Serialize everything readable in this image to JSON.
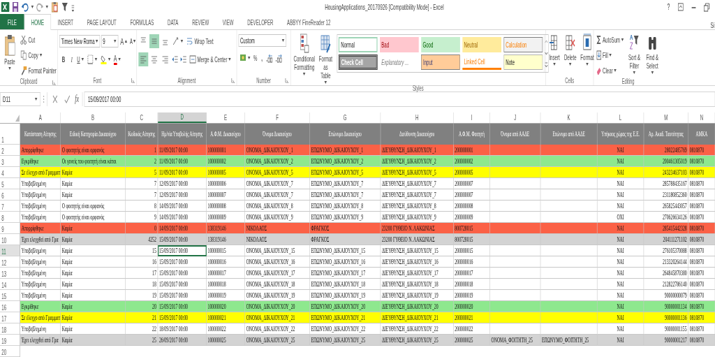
{
  "title_bar": {
    "title": "HousingApplications_20170926  [Compatibility Mode] - Excel",
    "help": "?"
  },
  "tabs": [
    {
      "label": "FILE",
      "kind": "file",
      "selected": false
    },
    {
      "label": "HOME",
      "kind": "tab",
      "selected": true
    },
    {
      "label": "INSERT",
      "kind": "tab",
      "selected": false
    },
    {
      "label": "PAGE LAYOUT",
      "kind": "tab",
      "selected": false
    },
    {
      "label": "FORMULAS",
      "kind": "tab",
      "selected": false
    },
    {
      "label": "DATA",
      "kind": "tab",
      "selected": false
    },
    {
      "label": "REVIEW",
      "kind": "tab",
      "selected": false
    },
    {
      "label": "VIEW",
      "kind": "tab",
      "selected": false
    },
    {
      "label": "DEVELOPER",
      "kind": "tab",
      "selected": false
    },
    {
      "label": "ABBYY FineReader 12",
      "kind": "tab",
      "selected": false
    }
  ],
  "account_label": "Si",
  "ribbon": {
    "clipboard": {
      "label": "Clipboard",
      "paste": "Paste",
      "cut": "Cut",
      "copy": "Copy",
      "format_painter": "Format Painter"
    },
    "font": {
      "label": "Font",
      "font_name": "Times New Roma",
      "font_size": "9",
      "grow": "A",
      "shrink": "A",
      "bold": "B",
      "italic": "I",
      "underline": "U",
      "font_color": "A"
    },
    "alignment": {
      "label": "Alignment",
      "top_row": [
        {
          "kind": "top",
          "selected": false
        },
        {
          "kind": "middle",
          "selected": true
        },
        {
          "kind": "bottom",
          "selected": false
        }
      ],
      "bottom_row": [
        {
          "kind": "left",
          "selected": true
        },
        {
          "kind": "center",
          "selected": false
        },
        {
          "kind": "right",
          "selected": false
        }
      ],
      "wrap_text": "Wrap Text",
      "merge_center": "Merge & Center"
    },
    "number": {
      "label": "Number",
      "format": "Custom",
      "percent": "%",
      "comma": ","
    },
    "styles": {
      "label": "Styles",
      "conditional_formatting": "Conditional Formatting",
      "format_as_table": "Format as Table",
      "gallery": [
        {
          "name": "Normal",
          "kind": "normal"
        },
        {
          "name": "Bad",
          "kind": "bad"
        },
        {
          "name": "Good",
          "kind": "good"
        },
        {
          "name": "Neutral",
          "kind": "neutral"
        },
        {
          "name": "Calculation",
          "kind": "calculation"
        },
        {
          "name": "Check Cell",
          "kind": "check"
        },
        {
          "name": "Explanatory ...",
          "kind": "explanatory"
        },
        {
          "name": "Input",
          "kind": "input"
        },
        {
          "name": "Linked Cell",
          "kind": "linked"
        },
        {
          "name": "Note",
          "kind": "note"
        }
      ]
    },
    "cells": {
      "label": "Cells",
      "insert": "Insert",
      "delete": "Delete",
      "format": "Format"
    },
    "editing": {
      "label": "Editing",
      "autosum": "AutoSum",
      "fill": "Fill",
      "clear": "Clear",
      "sort_filter": "Sort & Filter",
      "find_select": "Find & Select"
    }
  },
  "formula_bar": {
    "name_box": "D11",
    "fx": "fx",
    "value": "15/09/2017 00:00"
  },
  "sheet": {
    "columns": [
      {
        "letter": "A",
        "header": "Κατάσταση Αίτησης",
        "kind": "text",
        "selected": false
      },
      {
        "letter": "B",
        "header": "Ειδική Κατηγορία Δικαιούχου",
        "kind": "text",
        "selected": false
      },
      {
        "letter": "C",
        "header": "Κωδικός Αίτησης",
        "kind": "number",
        "selected": false
      },
      {
        "letter": "D",
        "header": "Ημ/νία Υποβολής Αίτησης",
        "kind": "text",
        "selected": true
      },
      {
        "letter": "E",
        "header": "Α.Φ.Μ. Δικαιούχου",
        "kind": "text",
        "selected": false
      },
      {
        "letter": "F",
        "header": "Όνομα Δικαιούχου",
        "kind": "text",
        "selected": false
      },
      {
        "letter": "G",
        "header": "Επώνυμο Δικαιούχου",
        "kind": "text",
        "selected": false
      },
      {
        "letter": "H",
        "header": "Διεύθυνση Δικαιούχου",
        "kind": "text",
        "selected": false
      },
      {
        "letter": "I",
        "header": "Α.Φ.Μ. Φοιτητή",
        "kind": "text",
        "selected": false
      },
      {
        "letter": "J",
        "header": "Όνομα από ΑΑΔΕ",
        "kind": "text",
        "selected": false
      },
      {
        "letter": "K",
        "header": "Επώνυμο από ΑΑΔΕ",
        "kind": "text",
        "selected": false
      },
      {
        "letter": "L",
        "header": "Υπήκοος χώρας της Ε.Ε.",
        "kind": "flag",
        "selected": false
      },
      {
        "letter": "M",
        "header": "Αρ. Ακαδ. Ταυτότητας",
        "kind": "number",
        "selected": false
      },
      {
        "letter": "N",
        "header": "ΑΜΚΑ",
        "kind": "text",
        "selected": false
      }
    ],
    "header_row_number": "1",
    "rows": [
      {
        "number": "2",
        "color": "#fb6146",
        "selected": false,
        "cells": {
          "A": "Απορρίφθηκε",
          "B": "Ο φοιτητής είναι ορφανός",
          "C": "1",
          "D": "11/09/2017 00:00",
          "E": "100000001",
          "F": "ΟΝΟΜΑ_ΔΙΚΑΙΟΥΧΟΥ_1",
          "G": "ΕΠΩΝΥΜΟ_ΔΙΚΑΙΟΥΧΟΥ_1",
          "H": "ΔΙΕΥΘΥΝΣΗ_ΔΙΚΑΙΟΥΧΟΥ_1",
          "I": "200000001",
          "L": "ΝΑΙ",
          "M": "28022485769",
          "N": "0810870"
        }
      },
      {
        "number": "3",
        "color": "#8ee88e",
        "selected": false,
        "cells": {
          "A": "Εγκρίθηκε",
          "B": "Οι γονείς του φοιτητή είναι κάτοι",
          "C": "2",
          "D": "11/09/2017 00:00",
          "E": "100000002",
          "F": "ΟΝΟΜΑ_ΔΙΚΑΙΟΥΧΟΥ_2",
          "G": "ΕΠΩΝΥΜΟ_ΔΙΚΑΙΟΥΧΟΥ_2",
          "H": "ΔΙΕΥΘΥΝΣΗ_ΔΙΚΑΙΟΥΧΟΥ_2",
          "I": "200000002",
          "L": "ΝΑΙ",
          "M": "200461305019",
          "N": "0810870"
        }
      },
      {
        "number": "4",
        "color": "#ffff00",
        "selected": false,
        "cells": {
          "A": "Σε έλεγχο από Γραμματ",
          "B": "Καμία",
          "C": "5",
          "D": "11/09/2017 00:00",
          "E": "100000005",
          "F": "ΟΝΟΜΑ_ΔΙΚΑΙΟΥΧΟΥ_5",
          "G": "ΕΠΩΝΥΜΟ_ΔΙΚΑΙΟΥΧΟΥ_5",
          "H": "ΔΙΕΥΘΥΝΣΗ_ΔΙΚΑΙΟΥΧΟΥ_5",
          "I": "200000005",
          "L": "ΝΑΙ",
          "M": "243234637103",
          "N": "0810870"
        }
      },
      {
        "number": "5",
        "color": "#ffffff",
        "selected": false,
        "cells": {
          "A": "Υποβεβλημένη",
          "B": "Καμία",
          "C": "7",
          "D": "12/09/2017 00:00",
          "E": "100000006",
          "F": "ΟΝΟΜΑ_ΔΙΚΑΙΟΥΧΟΥ_7",
          "G": "ΕΠΩΝΥΜΟ_ΔΙΚΑΙΟΥΧΟΥ_7",
          "H": "ΔΙΕΥΘΥΝΣΗ_ΔΙΚΑΙΟΥΧΟΥ_7",
          "I": "200000007",
          "L": "ΝΑΙ",
          "M": "285788435167",
          "N": "0810870"
        }
      },
      {
        "number": "6",
        "color": "#ffffff",
        "selected": false,
        "cells": {
          "A": "Υποβεβλημένη",
          "B": "Καμία",
          "C": "7",
          "D": "12/09/2017 00:00",
          "E": "100000007",
          "F": "ΟΝΟΜΑ_ΔΙΚΑΙΟΥΧΟΥ_7",
          "G": "ΕΠΩΝΥΜΟ_ΔΙΚΑΙΟΥΧΟΥ_7",
          "H": "ΔΙΕΥΘΥΝΣΗ_ΔΙΚΑΙΟΥΧΟΥ_7",
          "I": "200000007",
          "L": "ΝΑΙ",
          "M": "231180852360",
          "N": "0810870"
        }
      },
      {
        "number": "7",
        "color": "#ffffff",
        "selected": false,
        "cells": {
          "A": "Υποβεβλημένη",
          "B": "Ο φοιτητής είναι ορφανός",
          "C": "8",
          "D": "14/09/2017 00:00",
          "E": "100000008",
          "F": "ΟΝΟΜΑ_ΔΙΚΑΙΟΥΧΟΥ_8",
          "G": "ΕΠΩΝΥΜΟ_ΔΙΚΑΙΟΥΧΟΥ_8",
          "H": "ΔΙΕΥΘΥΝΣΗ_ΔΙΚΑΙΟΥΧΟΥ_8",
          "I": "200000008",
          "L": "ΝΑΙ",
          "M": "265825443057",
          "N": "0810870"
        }
      },
      {
        "number": "8",
        "color": "#ffffff",
        "selected": false,
        "cells": {
          "A": "Υποβεβλημένη",
          "B": "Ο φοιτητής είναι ορφανός",
          "C": "9",
          "D": "14/09/2017 00:00",
          "E": "100000009",
          "F": "ΟΝΟΜΑ_ΔΙΚΑΙΟΥΧΟΥ_9",
          "G": "ΕΠΩΝΥΜΟ_ΔΙΚΑΙΟΥΧΟΥ_9",
          "H": "ΔΙΕΥΘΥΝΣΗ_ΔΙΚΑΙΟΥΧΟΥ_9",
          "I": "200000009",
          "L": "ΟΧΙ",
          "M": "270626634126",
          "N": "0810870"
        }
      },
      {
        "number": "9",
        "color": "#fb6146",
        "selected": false,
        "cells": {
          "A": "Απορρίφθηκε",
          "B": "Καμία",
          "C": "0",
          "D": "14/09/2017 00:00",
          "E": "138319146",
          "F": "ΝΙΚΟΛΑΟΣ",
          "G": "ΦΡΑΓΚΟΣ",
          "H": "23200  ΓΥΘΕΙΟ  Ν. ΛΑΚΩΝΙΑΣ",
          "I": "800728015",
          "L": "ΝΑΙ",
          "M": "285415442328",
          "N": "0810870"
        }
      },
      {
        "number": "10",
        "color": "#d3d3d3",
        "selected": false,
        "cells": {
          "A": "Έχει ελεγχθεί από Γρα",
          "B": "Καμία",
          "C": "4252",
          "D": "15/09/2017 00:00",
          "E": "138319146",
          "F": "ΝΙΚΟΛΑΟΣ",
          "G": "ΦΡΑΓΚΟΣ",
          "H": "23200  ΓΥΘΕΙΟ  Ν. ΛΑΚΩΝΙΑΣ",
          "I": "800728015",
          "L": "ΝΑΙ",
          "M": "204111271102",
          "N": "0810870"
        }
      },
      {
        "number": "11",
        "color": "#ffffff",
        "selected": true,
        "cells": {
          "A": "Υποβεβλημένη",
          "B": "Καμία",
          "C": "15",
          "D": "15/09/2017 00:00",
          "E": "100000015",
          "F": "ΟΝΟΜΑ_ΔΙΚΑΙΟΥΧΟΥ_15",
          "G": "ΕΠΩΝΥΜΟ_ΔΙΚΑΙΟΥΧΟΥ_15",
          "H": "ΔΙΕΥΘΥΝΣΗ_ΔΙΚΑΙΟΥΧΟΥ_15",
          "I": "200000015",
          "L": "ΝΑΙ",
          "M": "276105370088",
          "N": "0810870"
        }
      },
      {
        "number": "12",
        "color": "#ffffff",
        "selected": false,
        "cells": {
          "A": "Υποβεβλημένη",
          "B": "Καμία",
          "C": "16",
          "D": "15/09/2017 00:00",
          "E": "100000016",
          "F": "ΟΝΟΜΑ_ΔΙΚΑΙΟΥΧΟΥ_16",
          "G": "ΕΠΩΝΥΜΟ_ΔΙΚΑΙΟΥΧΟΥ_16",
          "H": "ΔΙΕΥΘΥΝΣΗ_ΔΙΚΑΙΟΥΧΟΥ_16",
          "I": "200000016",
          "L": "ΝΑΙ",
          "M": "213320264144",
          "N": "0810870"
        }
      },
      {
        "number": "13",
        "color": "#ffffff",
        "selected": false,
        "cells": {
          "A": "Υποβεβλημένη",
          "B": "Καμία",
          "C": "17",
          "D": "15/09/2017 00:00",
          "E": "100000017",
          "F": "ΟΝΟΜΑ_ΔΙΚΑΙΟΥΧΟΥ_17",
          "G": "ΕΠΩΝΥΜΟ_ΔΙΚΑΙΟΥΧΟΥ_17",
          "H": "ΔΙΕΥΘΥΝΣΗ_ΔΙΚΑΙΟΥΧΟΥ_17",
          "I": "200000017",
          "L": "ΝΑΙ",
          "M": "264845870380",
          "N": "0810870"
        }
      },
      {
        "number": "14",
        "color": "#ffffff",
        "selected": false,
        "cells": {
          "A": "Υποβεβλημένη",
          "B": "Καμία",
          "C": "18",
          "D": "15/09/2017 00:00",
          "E": "100000018",
          "F": "ΟΝΟΜΑ_ΔΙΚΑΙΟΥΧΟΥ_18",
          "G": "ΕΠΩΝΥΜΟ_ΔΙΚΑΙΟΥΧΟΥ_18",
          "H": "ΔΙΕΥΘΥΝΣΗ_ΔΙΚΑΙΟΥΧΟΥ_18",
          "I": "200000018",
          "L": "ΝΑΙ",
          "M": "212822786140",
          "N": "0810870"
        }
      },
      {
        "number": "15",
        "color": "#ffffff",
        "selected": false,
        "cells": {
          "A": "Υποβεβλημένη",
          "B": "Καμία",
          "C": "19",
          "D": "15/09/2017 00:00",
          "E": "100000019",
          "F": "ΟΝΟΜΑ_ΔΙΚΑΙΟΥΧΟΥ_19",
          "G": "ΕΠΩΝΥΜΟ_ΔΙΚΑΙΟΥΧΟΥ_19",
          "H": "ΔΙΕΥΘΥΝΣΗ_ΔΙΚΑΙΟΥΧΟΥ_19",
          "I": "200000019",
          "L": "ΝΑΙ",
          "M": "90000000079",
          "N": "0810870"
        }
      },
      {
        "number": "16",
        "color": "#8ee88e",
        "selected": false,
        "cells": {
          "A": "Εγκρίθηκε",
          "B": "Καμία",
          "C": "20",
          "D": "15/09/2017 00:00",
          "E": "100000020",
          "F": "ΟΝΟΜΑ_ΔΙΚΑΙΟΥΧΟΥ_20",
          "G": "ΕΠΩΝΥΜΟ_ΔΙΚΑΙΟΥΧΟΥ_20",
          "H": "ΔΙΕΥΘΥΝΣΗ_ΔΙΚΑΙΟΥΧΟΥ_20",
          "I": "200000020",
          "L": "ΝΑΙ",
          "M": "90000001134",
          "N": "0810870"
        }
      },
      {
        "number": "17",
        "color": "#ffff00",
        "selected": false,
        "cells": {
          "A": "Σε έλεγχο από Γραμματ",
          "B": "Καμία",
          "C": "21",
          "D": "15/09/2017 00:00",
          "E": "100000021",
          "F": "ΟΝΟΜΑ_ΔΙΚΑΙΟΥΧΟΥ_21",
          "G": "ΕΠΩΝΥΜΟ_ΔΙΚΑΙΟΥΧΟΥ_21",
          "H": "ΔΙΕΥΘΥΝΣΗ_ΔΙΚΑΙΟΥΧΟΥ_21",
          "I": "200000021",
          "L": "ΝΑΙ",
          "M": "90000001136",
          "N": "0810870"
        }
      },
      {
        "number": "18",
        "color": "#ffffff",
        "selected": false,
        "cells": {
          "A": "Υποβεβλημένη",
          "B": "Καμία",
          "C": "22",
          "D": "18/09/2017 00:00",
          "E": "100000022",
          "F": "ΟΝΟΜΑ_ΔΙΚΑΙΟΥΧΟΥ_22",
          "G": "ΕΠΩΝΥΜΟ_ΔΙΚΑΙΟΥΧΟΥ_22",
          "H": "ΔΙΕΥΘΥΝΣΗ_ΔΙΚΑΙΟΥΧΟΥ_22",
          "I": "200000022",
          "L": "ΝΑΙ",
          "M": "90000001155",
          "N": "0810870"
        }
      },
      {
        "number": "19",
        "color": "#d3d3d3",
        "selected": false,
        "cells": {
          "A": "Έχει ελεγχθεί από Γρα",
          "B": "Καμία",
          "C": "25",
          "D": "26/09/2017 00:00",
          "E": "100000025",
          "F": "ΟΝΟΜΑ_ΔΙΚΑΙΟΥΧΟΥ_25",
          "G": "ΕΠΩΝΥΜΟ_ΔΙΚΑΙΟΥΧΟΥ_25",
          "H": "ΔΙΕΥΘΥΝΣΗ_ΔΙΚΑΙΟΥΧΟΥ_25",
          "I": "200000025",
          "J": "ΟΝΟΜΑ_ΦΟΙΤΗΤΗ_25",
          "K": "ΕΠΩΝΥΜΟ_ΦΟΙΤΗΤΗ_25",
          "L": "ΝΑΙ",
          "M": "90000001217",
          "N": "0810870"
        }
      }
    ],
    "empty_row_numbers": [
      "20"
    ]
  }
}
